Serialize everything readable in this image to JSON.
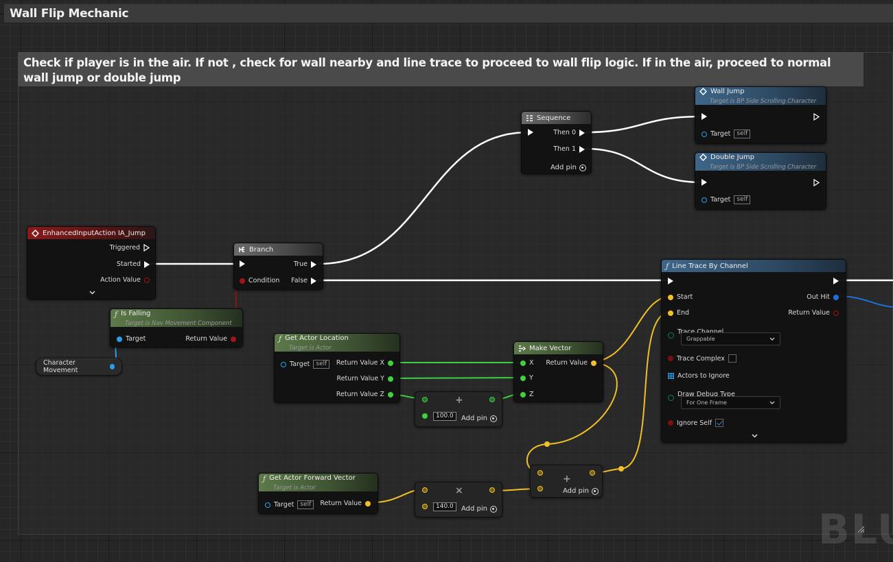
{
  "graph": {
    "title": "Wall Flip Mechanic",
    "comment": "Check if player is in the air. If not , check for wall nearby and line trace to proceed to wall flip logic. If in the air, proceed to normal wall jump or double jump",
    "watermark": "BLUEPRINT"
  },
  "colors": {
    "exec": "#ffffff",
    "bool": "#a31515",
    "object": "#2aa0e8",
    "vector": "#f2c029",
    "float": "#3fd13f",
    "struct": "#1e6fd9"
  },
  "nodes": {
    "input_event": {
      "title": "EnhancedInputAction IA_Jump",
      "pins": {
        "triggered": "Triggered",
        "started": "Started",
        "action_value": "Action Value"
      }
    },
    "branch": {
      "title": "Branch",
      "pins": {
        "condition": "Condition",
        "true": "True",
        "false": "False"
      }
    },
    "sequence": {
      "title": "Sequence",
      "pins": {
        "then0": "Then 0",
        "then1": "Then 1"
      },
      "add_pin": "Add pin"
    },
    "wall_jump": {
      "title": "Wall Jump",
      "subtitle": "Target is BP Side Scrolling Character",
      "target_label": "Target",
      "target_value": "self"
    },
    "double_jump": {
      "title": "Double Jump",
      "subtitle": "Target is BP Side Scrolling Character",
      "target_label": "Target",
      "target_value": "self"
    },
    "is_falling": {
      "title": "Is Falling",
      "subtitle": "Target is Nav Movement Component",
      "target_label": "Target",
      "return_label": "Return Value"
    },
    "character_movement": {
      "label": "Character Movement"
    },
    "get_actor_location": {
      "title": "Get Actor Location",
      "subtitle": "Target is Actor",
      "target_label": "Target",
      "target_value": "self",
      "rx": "Return Value X",
      "ry": "Return Value Y",
      "rz": "Return Value Z"
    },
    "make_vector": {
      "title": "Make Vector",
      "x": "X",
      "y": "Y",
      "z": "Z",
      "return_label": "Return Value"
    },
    "add_float": {
      "value": "100.0",
      "add_pin": "Add pin"
    },
    "line_trace": {
      "title": "Line Trace By Channel",
      "start": "Start",
      "end": "End",
      "out_hit": "Out Hit",
      "return_label": "Return Value",
      "trace_channel_label": "Trace Channel",
      "trace_channel_value": "Grappable",
      "trace_complex_label": "Trace Complex",
      "trace_complex_checked": false,
      "actors_to_ignore": "Actors to Ignore",
      "draw_debug_label": "Draw Debug Type",
      "draw_debug_value": "For One Frame",
      "ignore_self_label": "Ignore Self",
      "ignore_self_checked": true
    },
    "get_forward_vector": {
      "title": "Get Actor Forward Vector",
      "subtitle": "Target is Actor",
      "target_label": "Target",
      "target_value": "self",
      "return_label": "Return Value"
    },
    "multiply": {
      "value": "140.0",
      "add_pin": "Add pin"
    },
    "add_vector": {
      "add_pin": "Add pin"
    }
  }
}
